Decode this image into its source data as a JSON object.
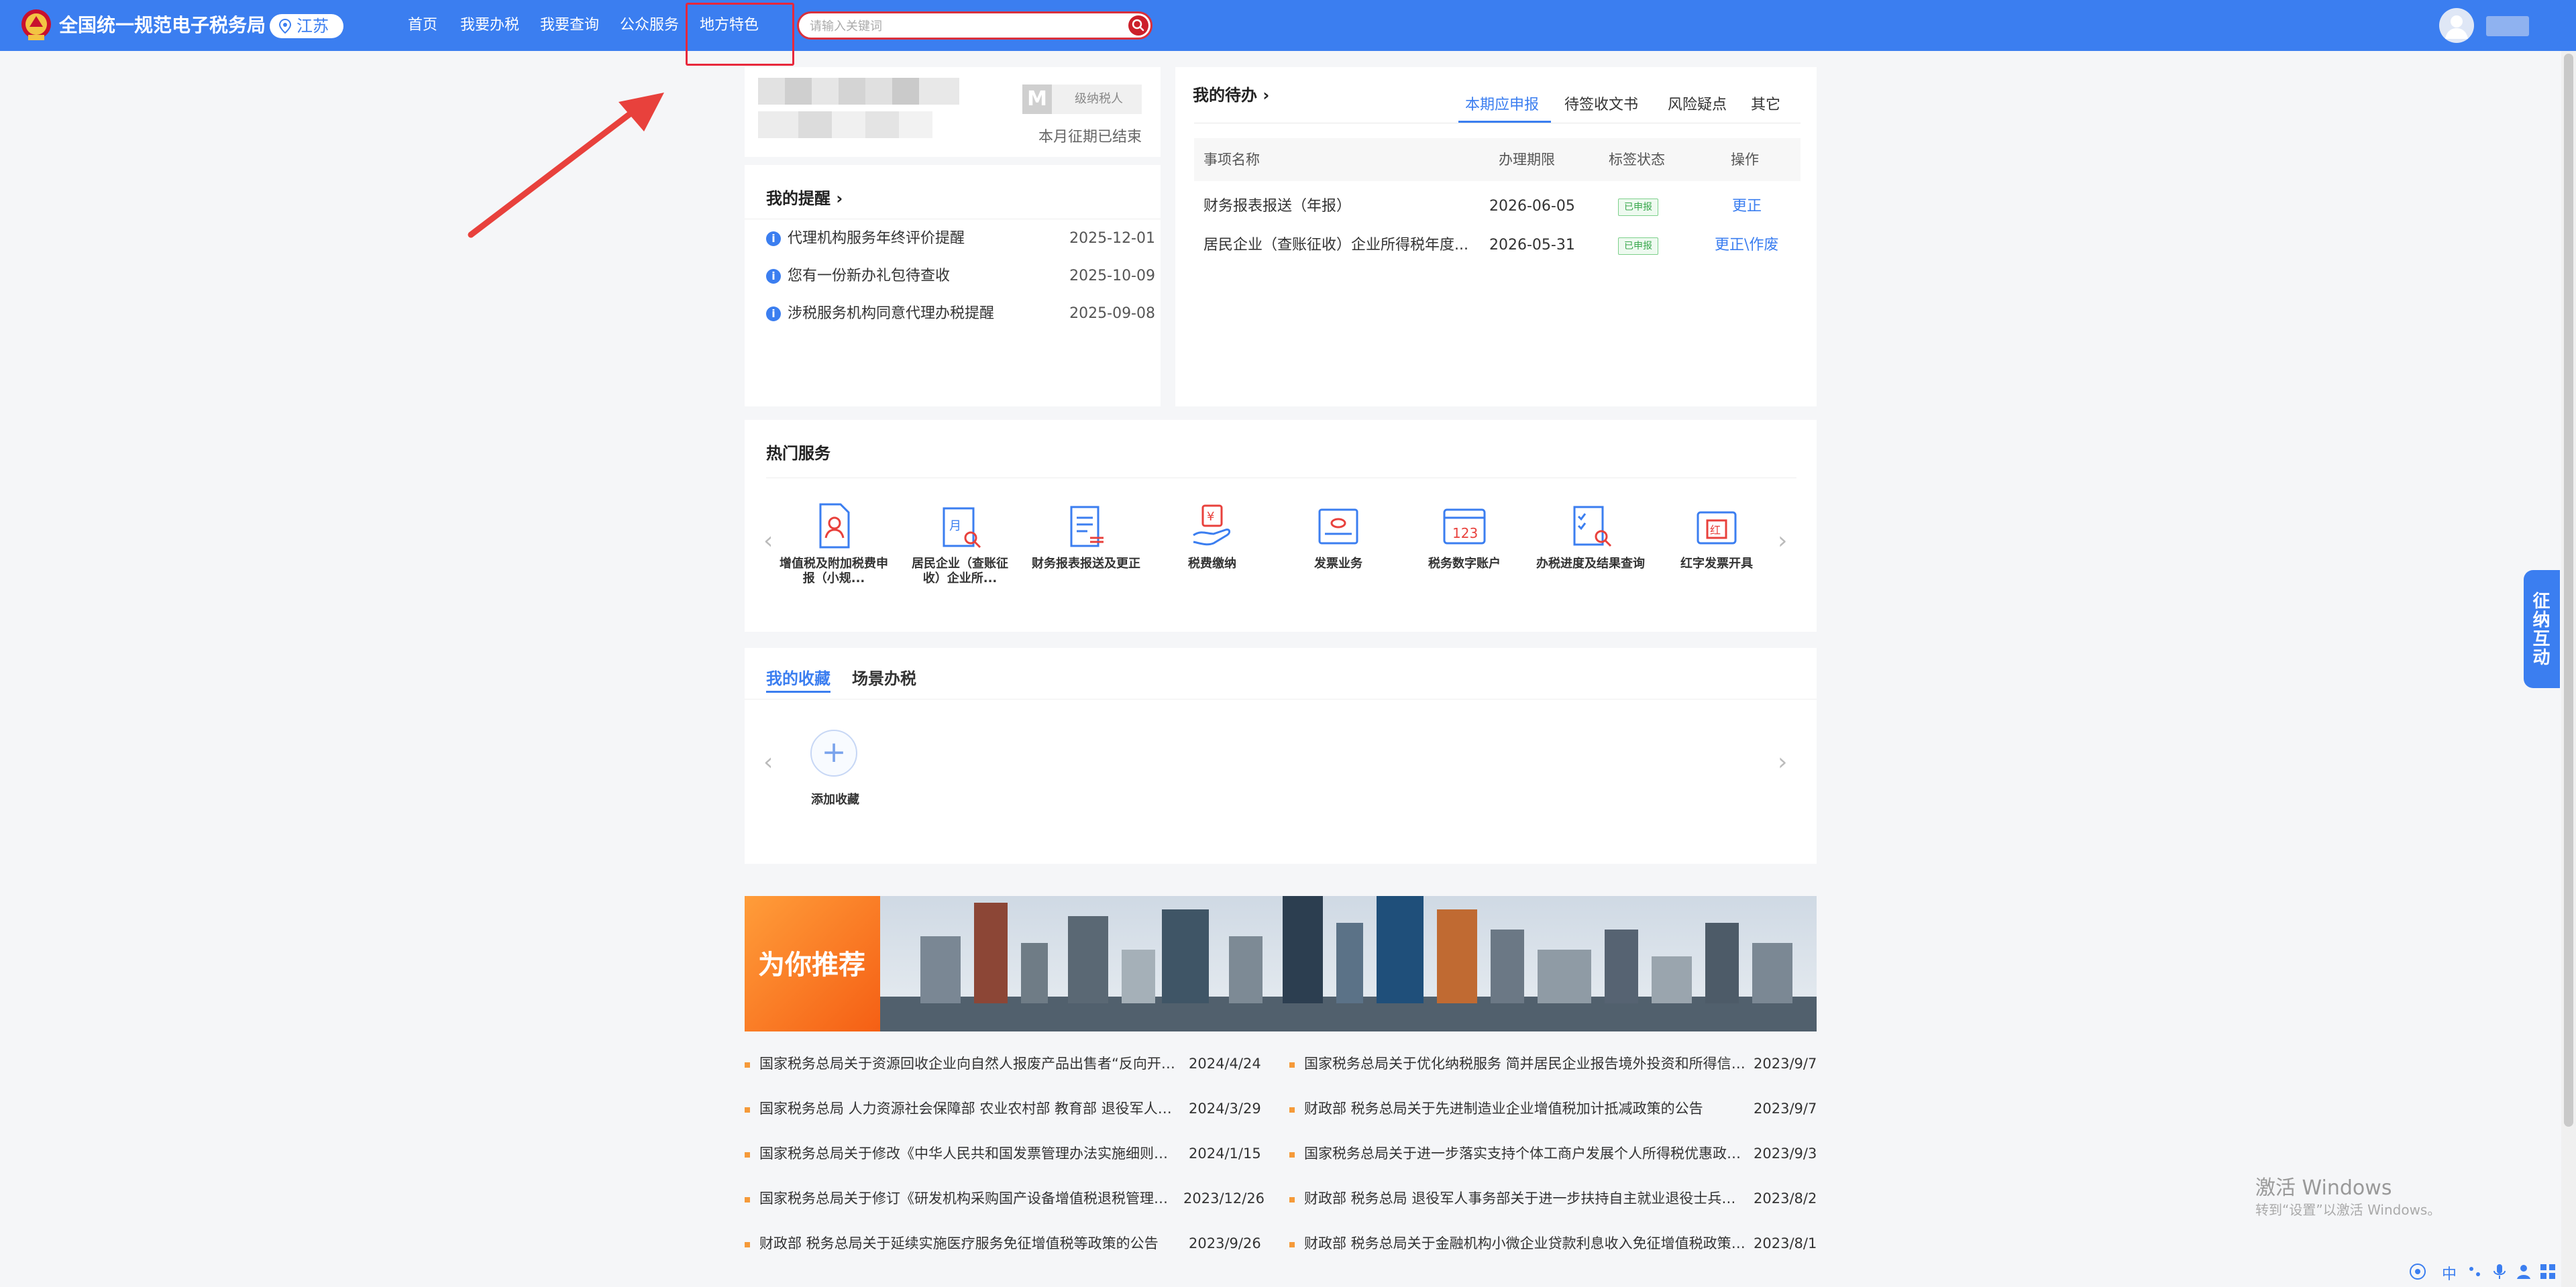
{
  "header": {
    "site_title": "全国统一规范电子税务局",
    "region": "江苏",
    "nav": [
      "首页",
      "我要办税",
      "我要查询",
      "公众服务",
      "地方特色"
    ],
    "search_placeholder": "请输入关键词"
  },
  "profile": {
    "badge_letter": "M",
    "taxpayer_level": "级纳税人",
    "period_status": "本月征期已结束"
  },
  "reminders": {
    "title": "我的提醒",
    "items": [
      {
        "text": "代理机构服务年终评价提醒",
        "date": "2025-12-01"
      },
      {
        "text": "您有一份新办礼包待查收",
        "date": "2025-10-09"
      },
      {
        "text": "涉税服务机构同意代理办税提醒",
        "date": "2025-09-08"
      }
    ]
  },
  "todo": {
    "title": "我的待办",
    "tabs": [
      "本期应申报",
      "待签收文书",
      "风险疑点",
      "其它"
    ],
    "columns": [
      "事项名称",
      "办理期限",
      "标签状态",
      "操作"
    ],
    "rows": [
      {
        "name": "财务报表报送（年报）",
        "deadline": "2026-06-05",
        "status": "已申报",
        "action": "更正"
      },
      {
        "name": "居民企业（查账征收）企业所得税年度...",
        "deadline": "2026-05-31",
        "status": "已申报",
        "action": "更正\\作废"
      }
    ]
  },
  "hot_services": {
    "title": "热门服务",
    "items": [
      {
        "label": "增值税及附加税费申报（小规...",
        "icon": "vat-declaration-icon"
      },
      {
        "label": "居民企业（查账征收）企业所...",
        "icon": "corporate-tax-icon"
      },
      {
        "label": "财务报表报送及更正",
        "icon": "financial-report-icon"
      },
      {
        "label": "税费缴纳",
        "icon": "tax-payment-icon"
      },
      {
        "label": "发票业务",
        "icon": "invoice-icon"
      },
      {
        "label": "税务数字账户",
        "icon": "digital-account-icon"
      },
      {
        "label": "办税进度及结果查询",
        "icon": "progress-query-icon"
      },
      {
        "label": "红字发票开具",
        "icon": "red-invoice-icon"
      }
    ]
  },
  "favorites": {
    "tabs": [
      "我的收藏",
      "场景办税"
    ],
    "add_label": "添加收藏"
  },
  "recommend": {
    "banner_title": "为你推荐",
    "left": [
      {
        "title": "国家税务总局关于资源回收企业向自然人报废产品出售者“反向开票”有关事项的公告",
        "date": "2024/4/24"
      },
      {
        "title": "国家税务总局 人力资源社会保障部 农业农村部 教育部 退役军人事务部关于重点群体和自主就业退役士兵创业就业税收政策有关执行问题的公告",
        "date": "2024/3/29"
      },
      {
        "title": "国家税务总局关于修改《中华人民共和国发票管理办法实施细则》的决定",
        "date": "2024/1/15"
      },
      {
        "title": "国家税务总局关于修订《研发机构采购国产设备增值税退税管理办法》的公告",
        "date": "2023/12/26"
      },
      {
        "title": "财政部 税务总局关于延续实施医疗服务免征增值税等政策的公告",
        "date": "2023/9/26"
      }
    ],
    "right": [
      {
        "title": "国家税务总局关于优化纳税服务 简并居民企业报告境外投资和所得信息有关报表的公告",
        "date": "2023/9/7"
      },
      {
        "title": "财政部 税务总局关于先进制造业企业增值税加计抵减政策的公告",
        "date": "2023/9/7"
      },
      {
        "title": "国家税务总局关于进一步落实支持个体工商户发展个人所得税优惠政策有关事项的公告",
        "date": "2023/9/3"
      },
      {
        "title": "财政部 税务总局 退役军人事务部关于进一步扶持自主就业退役士兵创业就业有关税收政策的公告",
        "date": "2023/8/2"
      },
      {
        "title": "财政部 税务总局关于金融机构小微企业贷款利息收入免征增值税政策的公告",
        "date": "2023/8/1"
      }
    ]
  },
  "side_tab": "征纳互动",
  "windows_activation": {
    "title": "激活 Windows",
    "subtitle": "转到“设置”以激活 Windows。"
  },
  "tray": {
    "ime": "中"
  },
  "colors": {
    "header_blue": "#3b7ef0",
    "highlight_red": "#e8283c",
    "banner_orange": "#f57a22",
    "status_green": "#39a84d"
  }
}
